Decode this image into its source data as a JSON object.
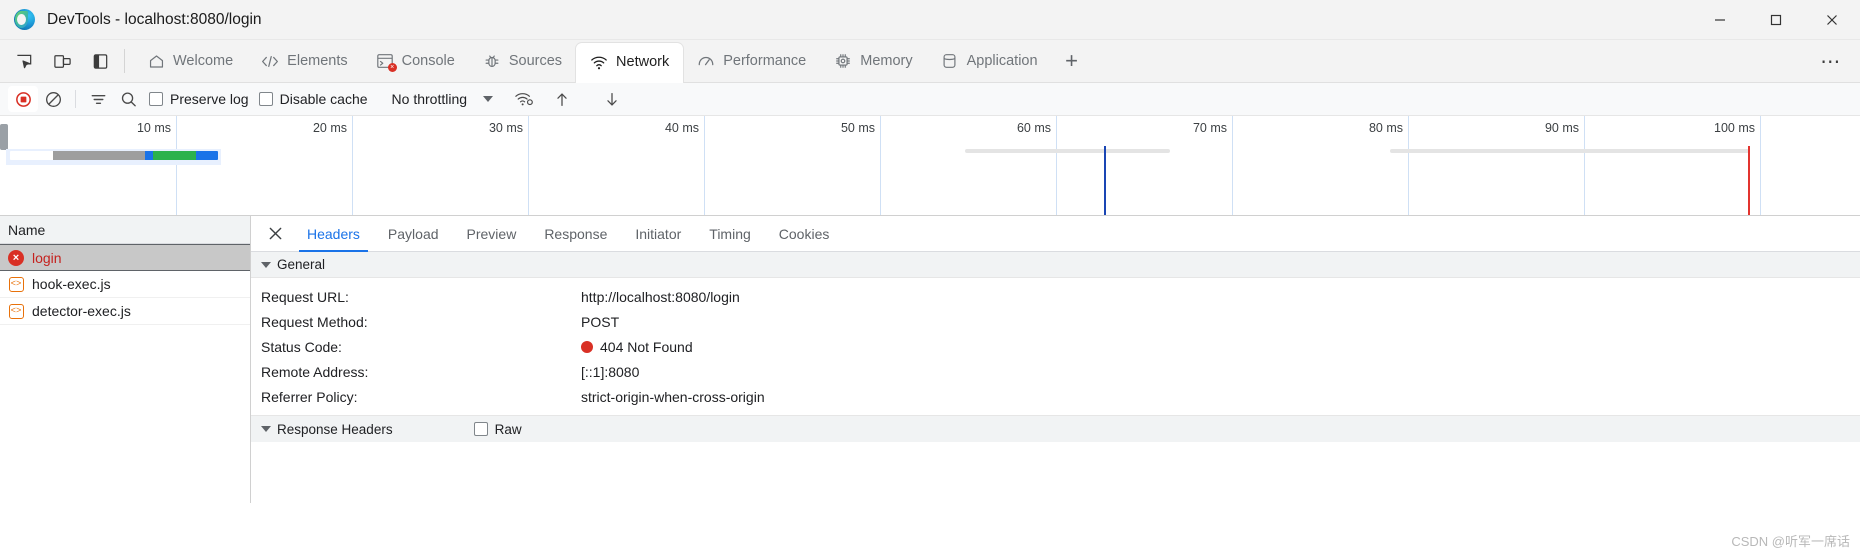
{
  "window": {
    "title": "DevTools - localhost:8080/login",
    "logo_icon": "edge-logo",
    "minimize_label": "─",
    "maximize_label": "☐",
    "close_label": "✕"
  },
  "toolstrip": {
    "left_icons": [
      {
        "name": "inspect-element-icon",
        "label": "Inspect"
      },
      {
        "name": "device-toolbar-icon",
        "label": "Toggle device toolbar"
      },
      {
        "name": "dock-side-icon",
        "label": "Dock side"
      }
    ],
    "more_label": "⋯",
    "add_tab_label": "+",
    "tabs": [
      {
        "label": "Welcome",
        "icon": "home-icon",
        "selected": false
      },
      {
        "label": "Elements",
        "icon": "code-brackets-icon",
        "selected": false
      },
      {
        "label": "Console",
        "icon": "console-prompt-icon",
        "selected": false,
        "badge": "×"
      },
      {
        "label": "Sources",
        "icon": "bug-icon",
        "selected": false
      },
      {
        "label": "Network",
        "icon": "wifi-icon",
        "selected": true
      },
      {
        "label": "Performance",
        "icon": "speedometer-icon",
        "selected": false
      },
      {
        "label": "Memory",
        "icon": "chip-icon",
        "selected": false
      },
      {
        "label": "Application",
        "icon": "database-icon",
        "selected": false
      }
    ]
  },
  "network_toolbar": {
    "record_icon": "record-stop-icon",
    "clear_icon": "clear-circle-slash-icon",
    "filter_icon": "filter-funnel-icon",
    "search_icon": "search-icon",
    "preserve_log_label": "Preserve log",
    "preserve_log_checked": false,
    "disable_cache_label": "Disable cache",
    "disable_cache_checked": false,
    "throttling_value": "No throttling",
    "throttling_caret": "chevron-down-icon",
    "network_conditions_icon": "wifi-settings-icon",
    "import_har_icon": "upload-arrow-icon",
    "export_har_icon": "download-arrow-icon"
  },
  "overview": {
    "tick_labels": [
      "10 ms",
      "20 ms",
      "30 ms",
      "40 ms",
      "50 ms",
      "60 ms",
      "70 ms",
      "80 ms",
      "90 ms",
      "100 ms"
    ],
    "dom_content_loaded_color": "#1a46b4",
    "load_event_color": "#e3342f",
    "request_bar_segments": [
      {
        "name": "queueing",
        "color": "#ffffff"
      },
      {
        "name": "stalled",
        "color": "#9e9e9e"
      },
      {
        "name": "request-sent",
        "color": "#1a73e8"
      },
      {
        "name": "waiting-ttfb",
        "color": "#2bb24c"
      },
      {
        "name": "content-download",
        "color": "#1a73e8"
      }
    ]
  },
  "request_list": {
    "column_header": "Name",
    "rows": [
      {
        "name": "login",
        "icon": "error-circle-icon",
        "selected": true
      },
      {
        "name": "hook-exec.js",
        "icon": "js-file-icon",
        "selected": false
      },
      {
        "name": "detector-exec.js",
        "icon": "js-file-icon",
        "selected": false
      }
    ]
  },
  "details": {
    "close_icon": "close-icon",
    "tabs": [
      {
        "label": "Headers",
        "active": true
      },
      {
        "label": "Payload",
        "active": false
      },
      {
        "label": "Preview",
        "active": false
      },
      {
        "label": "Response",
        "active": false
      },
      {
        "label": "Initiator",
        "active": false
      },
      {
        "label": "Timing",
        "active": false
      },
      {
        "label": "Cookies",
        "active": false
      }
    ],
    "general_section": {
      "title": "General",
      "expanded": true,
      "rows": [
        {
          "key": "Request URL:",
          "value": "http://localhost:8080/login",
          "status": false
        },
        {
          "key": "Request Method:",
          "value": "POST",
          "status": false
        },
        {
          "key": "Status Code:",
          "value": "404 Not Found",
          "status": true
        },
        {
          "key": "Remote Address:",
          "value": "[::1]:8080",
          "status": false
        },
        {
          "key": "Referrer Policy:",
          "value": "strict-origin-when-cross-origin",
          "status": false
        }
      ]
    },
    "response_headers_section": {
      "title": "Response Headers",
      "raw_label": "Raw",
      "raw_checked": false
    }
  },
  "watermark": "CSDN @听军一席话",
  "colors": {
    "accent_blue": "#1a73e8",
    "error_red": "#d93025",
    "js_orange": "#e8710a",
    "toolbar_bg": "#f3f3f3"
  }
}
